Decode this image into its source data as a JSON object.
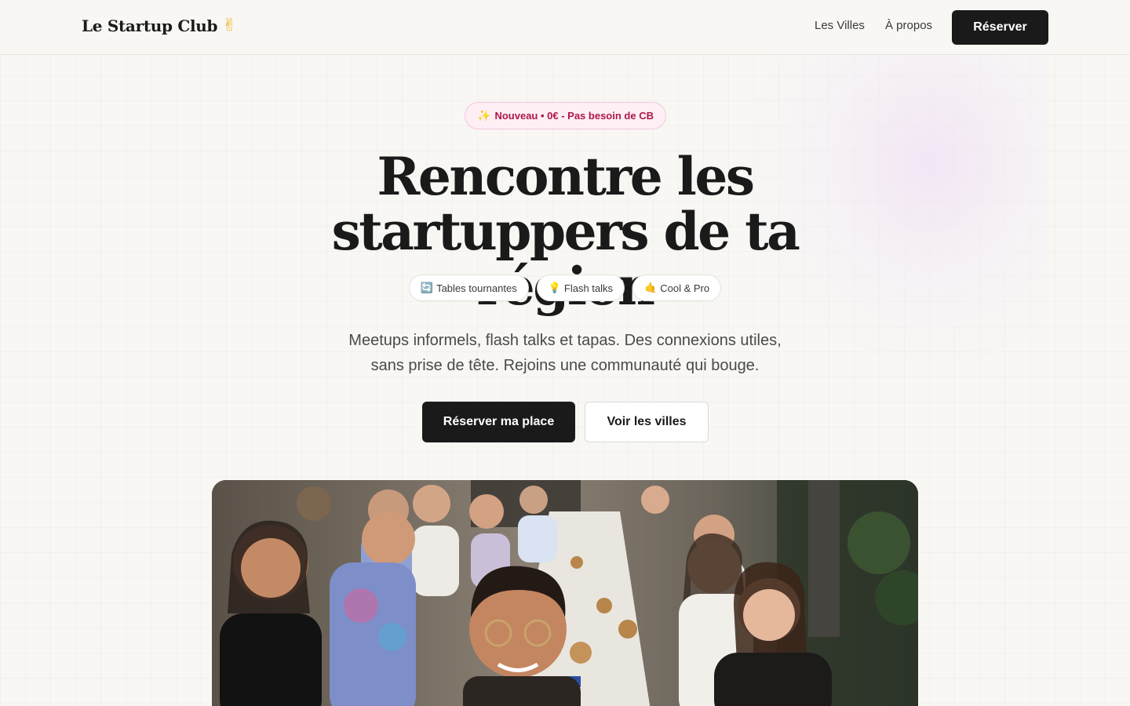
{
  "nav": {
    "brand": "Le Startup Club",
    "brand_icon": "victory-hand-icon",
    "links": [
      "Les Villes",
      "À propos"
    ],
    "cta": "Réserver"
  },
  "hero": {
    "badge_icon": "sparkles-icon",
    "badge": "Nouveau • 0€ - Pas besoin de CB",
    "headline_line1": "Rencontre les",
    "headline_line2": "startuppers de ta région",
    "tags": [
      {
        "icon": "rotate-arrows-icon",
        "label": "Tables tournantes"
      },
      {
        "icon": "light-bulb-icon",
        "label": "Flash talks"
      },
      {
        "icon": "call-me-hand-icon",
        "label": "Cool & Pro"
      }
    ],
    "description_line1": "Meetups informels, flash talks et tapas. Des connexions utiles,",
    "description_line2": "sans prise de tête. Rejoins une communauté qui bouge.",
    "cta_primary": "Réserver ma place",
    "cta_secondary": "Voir les villes"
  },
  "photo": {
    "subject": "group-selfie-photo"
  }
}
